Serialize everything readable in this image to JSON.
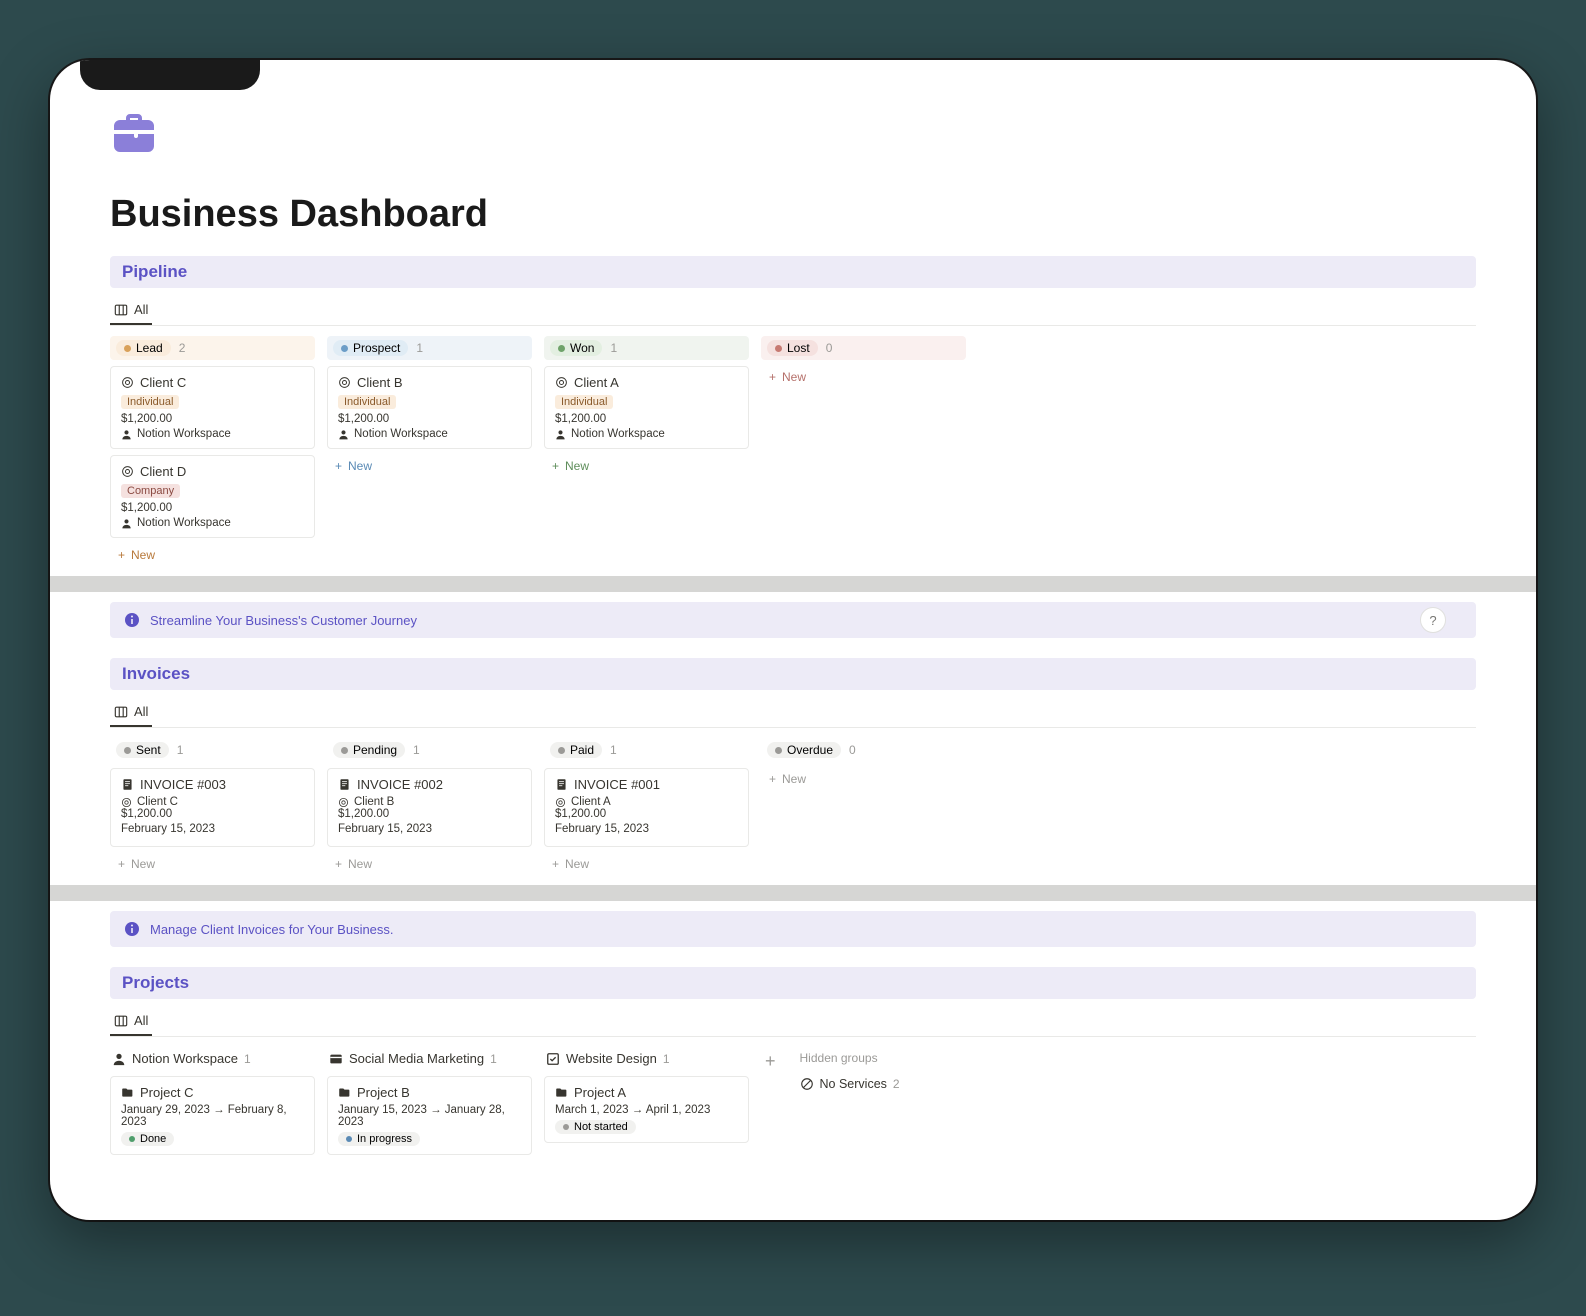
{
  "page": {
    "title": "Business Dashboard"
  },
  "view": {
    "tab_all": "All"
  },
  "common": {
    "new": "New",
    "plus": "+"
  },
  "pipeline": {
    "title": "Pipeline",
    "columns": [
      {
        "label": "Lead",
        "count": "2",
        "cards": [
          {
            "name": "Client C",
            "type": "Individual",
            "amount": "$1,200.00",
            "link": "Notion Workspace"
          },
          {
            "name": "Client D",
            "type": "Company",
            "amount": "$1,200.00",
            "link": "Notion Workspace"
          }
        ]
      },
      {
        "label": "Prospect",
        "count": "1",
        "cards": [
          {
            "name": "Client B",
            "type": "Individual",
            "amount": "$1,200.00",
            "link": "Notion Workspace"
          }
        ]
      },
      {
        "label": "Won",
        "count": "1",
        "cards": [
          {
            "name": "Client A",
            "type": "Individual",
            "amount": "$1,200.00",
            "link": "Notion Workspace"
          }
        ]
      },
      {
        "label": "Lost",
        "count": "0",
        "cards": []
      }
    ],
    "callout": "Streamline Your Business's Customer Journey"
  },
  "invoices": {
    "title": "Invoices",
    "columns": [
      {
        "label": "Sent",
        "count": "1",
        "cards": [
          {
            "name": "INVOICE #003",
            "client": "Client C",
            "amount": "$1,200.00",
            "date": "February 15, 2023"
          }
        ]
      },
      {
        "label": "Pending",
        "count": "1",
        "cards": [
          {
            "name": "INVOICE #002",
            "client": "Client B",
            "amount": "$1,200.00",
            "date": "February 15, 2023"
          }
        ]
      },
      {
        "label": "Paid",
        "count": "1",
        "cards": [
          {
            "name": "INVOICE #001",
            "client": "Client A",
            "amount": "$1,200.00",
            "date": "February 15, 2023"
          }
        ]
      },
      {
        "label": "Overdue",
        "count": "0",
        "cards": []
      }
    ],
    "callout": "Manage Client Invoices for Your Business."
  },
  "projects": {
    "title": "Projects",
    "columns": [
      {
        "label": "Notion Workspace",
        "count": "1",
        "cards": [
          {
            "name": "Project C",
            "dates": "January 29, 2023 → February 8, 2023",
            "status": "Done"
          }
        ]
      },
      {
        "label": "Social Media Marketing",
        "count": "1",
        "cards": [
          {
            "name": "Project B",
            "dates": "January 15, 2023 → January 28, 2023",
            "status": "In progress"
          }
        ]
      },
      {
        "label": "Website Design",
        "count": "1",
        "cards": [
          {
            "name": "Project A",
            "dates": "March 1, 2023 → April 1, 2023",
            "status": "Not started"
          }
        ]
      }
    ],
    "hidden_label": "Hidden groups",
    "hidden": {
      "label": "No Services",
      "count": "2"
    }
  },
  "help": "?"
}
